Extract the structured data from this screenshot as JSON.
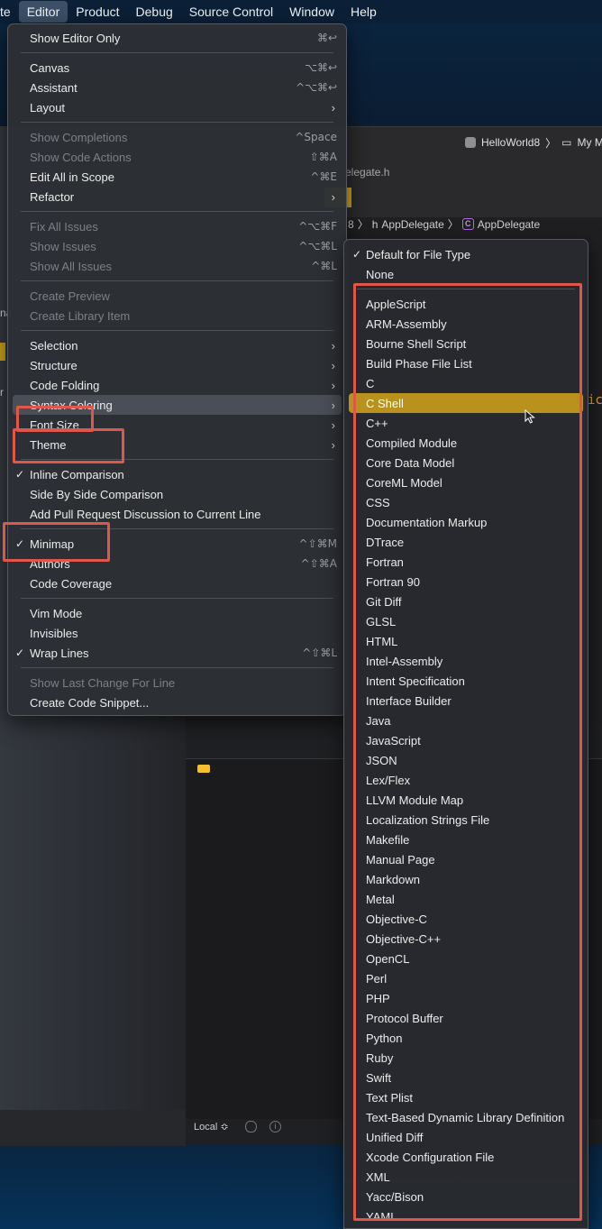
{
  "menubar": {
    "items": [
      "te",
      "Editor",
      "Product",
      "Debug",
      "Source Control",
      "Window",
      "Help"
    ],
    "active_index": 1
  },
  "editor_menu": {
    "items": [
      {
        "label": "Show Editor Only",
        "shortcut": "⌘↩",
        "enabled": true,
        "checked": false,
        "submenu": false
      },
      {
        "sep": true
      },
      {
        "label": "Canvas",
        "shortcut": "⌥⌘↩",
        "enabled": true,
        "checked": false,
        "submenu": false
      },
      {
        "label": "Assistant",
        "shortcut": "^⌥⌘↩",
        "enabled": true,
        "checked": false,
        "submenu": false
      },
      {
        "label": "Layout",
        "shortcut": "",
        "enabled": true,
        "checked": false,
        "submenu": true
      },
      {
        "sep": true
      },
      {
        "label": "Show Completions",
        "shortcut": "^Space",
        "enabled": false,
        "checked": false,
        "submenu": false
      },
      {
        "label": "Show Code Actions",
        "shortcut": "⇧⌘A",
        "enabled": false,
        "checked": false,
        "submenu": false
      },
      {
        "label": "Edit All in Scope",
        "shortcut": "^⌘E",
        "enabled": true,
        "checked": false,
        "submenu": false
      },
      {
        "label": "Refactor",
        "shortcut": "",
        "enabled": true,
        "checked": false,
        "submenu": true
      },
      {
        "sep": true
      },
      {
        "label": "Fix All Issues",
        "shortcut": "^⌥⌘F",
        "enabled": false,
        "checked": false,
        "submenu": false
      },
      {
        "label": "Show Issues",
        "shortcut": "^⌥⌘L",
        "enabled": false,
        "checked": false,
        "submenu": false
      },
      {
        "label": "Show All Issues",
        "shortcut": "^⌘L",
        "enabled": false,
        "checked": false,
        "submenu": false
      },
      {
        "sep": true
      },
      {
        "label": "Create Preview",
        "shortcut": "",
        "enabled": false,
        "checked": false,
        "submenu": false
      },
      {
        "label": "Create Library Item",
        "shortcut": "",
        "enabled": false,
        "checked": false,
        "submenu": false
      },
      {
        "sep": true
      },
      {
        "label": "Selection",
        "shortcut": "",
        "enabled": true,
        "checked": false,
        "submenu": true
      },
      {
        "label": "Structure",
        "shortcut": "",
        "enabled": true,
        "checked": false,
        "submenu": true
      },
      {
        "label": "Code Folding",
        "shortcut": "",
        "enabled": true,
        "checked": false,
        "submenu": true
      },
      {
        "label": "Syntax Coloring",
        "shortcut": "",
        "enabled": true,
        "checked": false,
        "submenu": true,
        "highlighted": true
      },
      {
        "label": "Font Size",
        "shortcut": "",
        "enabled": true,
        "checked": false,
        "submenu": true
      },
      {
        "label": "Theme",
        "shortcut": "",
        "enabled": true,
        "checked": false,
        "submenu": true
      },
      {
        "sep": true
      },
      {
        "label": "Inline Comparison",
        "shortcut": "",
        "enabled": true,
        "checked": true,
        "submenu": false
      },
      {
        "label": "Side By Side Comparison",
        "shortcut": "",
        "enabled": true,
        "checked": false,
        "submenu": false
      },
      {
        "label": "Add Pull Request Discussion to Current Line",
        "shortcut": "",
        "enabled": true,
        "checked": false,
        "submenu": false
      },
      {
        "sep": true
      },
      {
        "label": "Minimap",
        "shortcut": "^⇧⌘M",
        "enabled": true,
        "checked": true,
        "submenu": false
      },
      {
        "label": "Authors",
        "shortcut": "^⇧⌘A",
        "enabled": true,
        "checked": false,
        "submenu": false
      },
      {
        "label": "Code Coverage",
        "shortcut": "",
        "enabled": true,
        "checked": false,
        "submenu": false
      },
      {
        "sep": true
      },
      {
        "label": "Vim Mode",
        "shortcut": "",
        "enabled": true,
        "checked": false,
        "submenu": false
      },
      {
        "label": "Invisibles",
        "shortcut": "",
        "enabled": true,
        "checked": false,
        "submenu": false
      },
      {
        "label": "Wrap Lines",
        "shortcut": "^⇧⌘L",
        "enabled": true,
        "checked": true,
        "submenu": false
      },
      {
        "sep": true
      },
      {
        "label": "Show Last Change For Line",
        "shortcut": "",
        "enabled": false,
        "checked": false,
        "submenu": false
      },
      {
        "label": "Create Code Snippet...",
        "shortcut": "",
        "enabled": true,
        "checked": false,
        "submenu": false
      }
    ]
  },
  "syntax_submenu": {
    "top": [
      {
        "label": "Default for File Type",
        "checked": true
      },
      {
        "label": "None",
        "checked": false
      }
    ],
    "languages": [
      "AppleScript",
      "ARM-Assembly",
      "Bourne Shell Script",
      "Build Phase File List",
      "C",
      "C Shell",
      "C++",
      "Compiled Module",
      "Core Data Model",
      "CoreML Model",
      "CSS",
      "Documentation Markup",
      "DTrace",
      "Fortran",
      "Fortran 90",
      "Git Diff",
      "GLSL",
      "HTML",
      "Intel-Assembly",
      "Intent Specification",
      "Interface Builder",
      "Java",
      "JavaScript",
      "JSON",
      "Lex/Flex",
      "LLVM Module Map",
      "Localization Strings File",
      "Makefile",
      "Manual Page",
      "Markdown",
      "Metal",
      "Objective-C",
      "Objective-C++",
      "OpenCL",
      "Perl",
      "PHP",
      "Protocol Buffer",
      "Python",
      "Ruby",
      "Swift",
      "Text Plist",
      "Text-Based Dynamic Library Definition",
      "Unified Diff",
      "Xcode Configuration File",
      "XML",
      "Yacc/Bison",
      "YAML"
    ],
    "selected": "C Shell"
  },
  "background": {
    "scheme": "HelloWorld8",
    "destination": "My Mac",
    "file_tab": "elegate.h",
    "tab_partial": "e",
    "crumb_prefix": "8",
    "crumb_header": "AppDelegate",
    "crumb_class": "AppDelegate",
    "class_badge": "C",
    "local_label": "Local ≎",
    "code_partial": "ic",
    "sidebar_partials": [
      "na",
      "r"
    ]
  },
  "colors": {
    "selection": "#b8921c",
    "annotation_red": "#e0564a",
    "menu_bg": "#2c2f35"
  }
}
